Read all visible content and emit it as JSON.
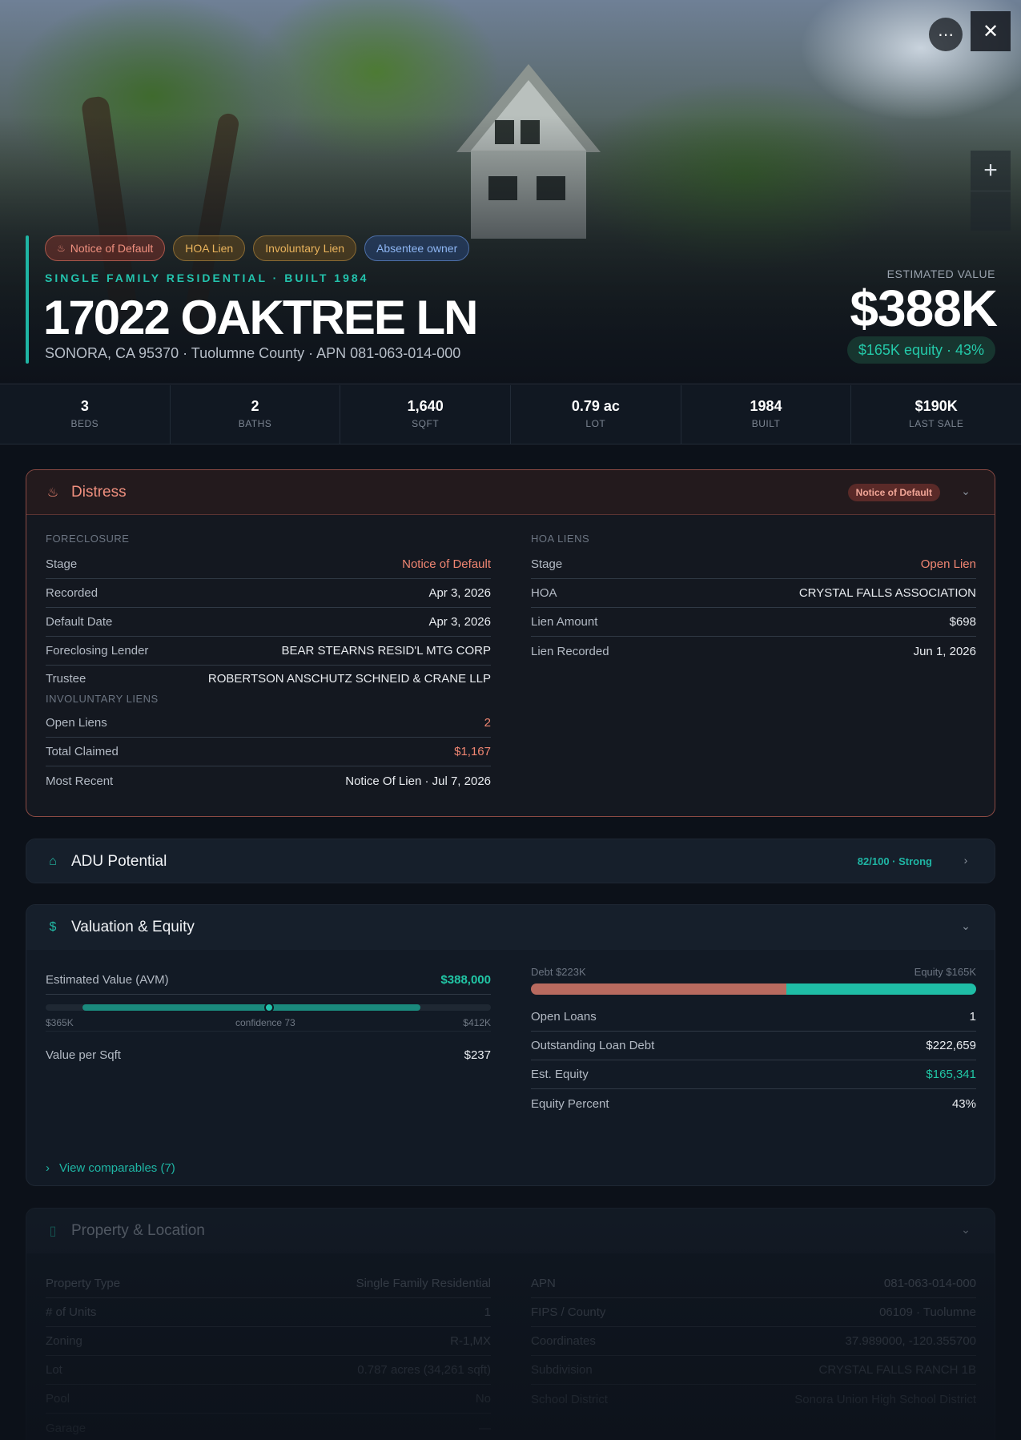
{
  "hero": {
    "chips": [
      {
        "label": "Notice of Default",
        "tone": "red",
        "icon": "flame-icon"
      },
      {
        "label": "HOA Lien",
        "tone": "amber"
      },
      {
        "label": "Involuntary Lien",
        "tone": "amber"
      },
      {
        "label": "Absentee owner",
        "tone": "blue"
      }
    ],
    "subtitle": "SINGLE FAMILY RESIDENTIAL · BUILT 1984",
    "address": "17022 OAKTREE LN",
    "location": "SONORA, CA 95370 · Tuolumne County · APN 081-063-014-000",
    "estimated_label": "ESTIMATED VALUE",
    "estimated_value": "$388K",
    "equity_pill": "$165K equity · 43%",
    "more_icon": "more-horizontal-icon",
    "close_icon": "close-icon",
    "zoom_in_icon": "plus-icon"
  },
  "stats": [
    {
      "value": "3",
      "label": "BEDS"
    },
    {
      "value": "2",
      "label": "BATHS"
    },
    {
      "value": "1,640",
      "label": "SQFT"
    },
    {
      "value": "0.79 ac",
      "label": "LOT"
    },
    {
      "value": "1984",
      "label": "BUILT"
    },
    {
      "value": "$190K",
      "label": "LAST SALE"
    }
  ],
  "distress": {
    "title": "Distress",
    "badge": "Notice of Default",
    "foreclosure": {
      "label": "FORECLOSURE",
      "rows": [
        {
          "k": "Stage",
          "v": "Notice of Default"
        },
        {
          "k": "Recorded",
          "v": "Apr 3, 2026"
        },
        {
          "k": "Default Date",
          "v": "Apr 3, 2026"
        },
        {
          "k": "Foreclosing Lender",
          "v": "BEAR STEARNS RESID'L MTG CORP"
        },
        {
          "k": "Trustee",
          "v": "ROBERTSON ANSCHUTZ SCHNEID & CRANE LLP"
        }
      ]
    },
    "involuntary": {
      "label": "INVOLUNTARY LIENS",
      "rows": [
        {
          "k": "Open Liens",
          "v": "2"
        },
        {
          "k": "Total Claimed",
          "v": "$1,167"
        },
        {
          "k": "Most Recent",
          "v": "Notice Of Lien · Jul 7, 2026"
        }
      ]
    },
    "hoa": {
      "label": "HOA LIENS",
      "rows": [
        {
          "k": "Stage",
          "v": "Open Lien"
        },
        {
          "k": "HOA",
          "v": "CRYSTAL FALLS ASSOCIATION"
        },
        {
          "k": "Lien Amount",
          "v": "$698"
        },
        {
          "k": "Lien Recorded",
          "v": "Jun 1, 2026"
        }
      ]
    }
  },
  "adu": {
    "title": "ADU Potential",
    "score": "82/100 · Strong"
  },
  "valuation": {
    "title": "Valuation & Equity",
    "avm_label": "Estimated Value (AVM)",
    "avm_value": "$388,000",
    "range_low": "$365K",
    "range_mid": "confidence 73",
    "range_high": "$412K",
    "sqft_label": "Value per Sqft",
    "sqft_value": "$237",
    "debt_label": "Debt $223K",
    "equity_label": "Equity $165K",
    "debt_fraction": 0.574,
    "rows": [
      {
        "k": "Open Loans",
        "v": "1"
      },
      {
        "k": "Outstanding Loan Debt",
        "v": "$222,659"
      },
      {
        "k": "Est. Equity",
        "v": "$165,341"
      },
      {
        "k": "Equity Percent",
        "v": "43%"
      }
    ],
    "comparables": "View comparables (7)"
  },
  "property": {
    "title": "Property & Location",
    "left": [
      {
        "k": "Property Type",
        "v": "Single Family Residential"
      },
      {
        "k": "# of Units",
        "v": "1"
      },
      {
        "k": "Zoning",
        "v": "R-1,MX"
      },
      {
        "k": "Lot",
        "v": "0.787 acres (34,261 sqft)"
      },
      {
        "k": "Pool",
        "v": "No"
      },
      {
        "k": "Garage",
        "v": "—"
      }
    ],
    "right": [
      {
        "k": "APN",
        "v": "081-063-014-000"
      },
      {
        "k": "FIPS / County",
        "v": "06109 · Tuolumne"
      },
      {
        "k": "Coordinates",
        "v": "37.989000, -120.355700"
      },
      {
        "k": "Subdivision",
        "v": "CRYSTAL FALLS RANCH 1B"
      },
      {
        "k": "School District",
        "v": "Sonora Union High School District"
      }
    ]
  }
}
